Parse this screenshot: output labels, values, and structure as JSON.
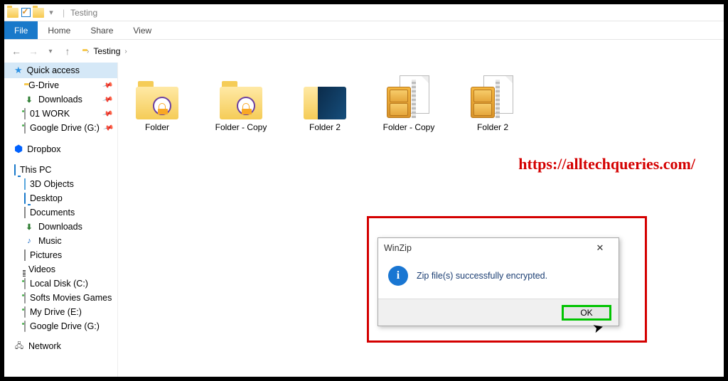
{
  "titlebar": {
    "title": "Testing"
  },
  "ribbon": {
    "file": "File",
    "home": "Home",
    "share": "Share",
    "view": "View"
  },
  "breadcrumb": {
    "root": "Testing"
  },
  "sidebar": {
    "quick_access": "Quick access",
    "pinned": {
      "gdrive": "G-Drive",
      "downloads": "Downloads",
      "work": "01 WORK",
      "googledrive_g": "Google Drive (G:)"
    },
    "dropbox": "Dropbox",
    "this_pc": "This PC",
    "pc_children": {
      "objects3d": "3D Objects",
      "desktop": "Desktop",
      "documents": "Documents",
      "downloads": "Downloads",
      "music": "Music",
      "pictures": "Pictures",
      "videos": "Videos",
      "local_c": "Local Disk (C:)",
      "softs": "Softs Movies Games",
      "mydrive_e": "My Drive (E:)",
      "googledrive_g": "Google Drive (G:)"
    },
    "network": "Network"
  },
  "items": {
    "i0": "Folder",
    "i1": "Folder - Copy",
    "i2": "Folder 2",
    "i3": "Folder - Copy",
    "i4": "Folder 2"
  },
  "watermark": "https://alltechqueries.com/",
  "dialog": {
    "title": "WinZip",
    "message": "Zip file(s) successfully encrypted.",
    "ok": "OK"
  }
}
